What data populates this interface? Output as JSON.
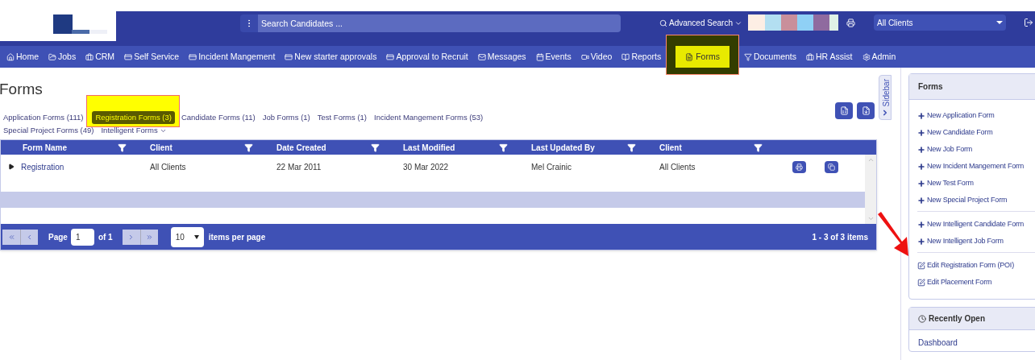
{
  "header": {
    "search": {
      "placeholder": "Search Candidates ..."
    },
    "advanced_search": "Advanced Search",
    "client_select": "All Clients"
  },
  "nav": [
    {
      "label": "Home",
      "selected": false
    },
    {
      "label": "Jobs",
      "selected": false
    },
    {
      "label": "CRM",
      "selected": false
    },
    {
      "label": "Self Service",
      "selected": false
    },
    {
      "label": "Incident Mangement",
      "selected": false
    },
    {
      "label": "New starter approvals",
      "selected": false
    },
    {
      "label": "Approval to Recruit",
      "selected": false
    },
    {
      "label": "Messages",
      "selected": false
    },
    {
      "label": "Events",
      "selected": false
    },
    {
      "label": "Video",
      "selected": false
    },
    {
      "label": "Reports",
      "selected": false
    },
    {
      "label": "Forms",
      "selected": true
    },
    {
      "label": "Documents",
      "selected": false
    },
    {
      "label": "HR Assist",
      "selected": false
    },
    {
      "label": "Admin",
      "selected": false
    }
  ],
  "page_title": "Forms",
  "tabs": [
    {
      "label": "Application Forms (111)",
      "kind": "link",
      "selected": false
    },
    {
      "label": "Registration Forms (3)",
      "kind": "link",
      "selected": true
    },
    {
      "label": "Candidate Forms (11)",
      "kind": "link",
      "selected": false
    },
    {
      "label": "Job Forms (1)",
      "kind": "link",
      "selected": false
    },
    {
      "label": "Test Forms (1)",
      "kind": "link",
      "selected": false
    },
    {
      "label": "Incident Mangement Forms (53)",
      "kind": "link",
      "selected": false
    },
    {
      "label": "Special Project Forms (49)",
      "kind": "link",
      "selected": false
    },
    {
      "label": "Intelligent Forms",
      "kind": "dropdown",
      "selected": false
    }
  ],
  "sidebar_tab": "Sidebar",
  "table": {
    "columns": [
      "Form Name",
      "Client",
      "Date Created",
      "Last Modified",
      "Last Updated By",
      "Client"
    ],
    "rows": [
      {
        "cells": [
          "Registration",
          "All Clients",
          "22 Mar 2011",
          "30 Mar 2022",
          "Mel Crainic",
          "All Clients"
        ]
      }
    ],
    "pager": {
      "page_label": "Page",
      "page": "1",
      "of": "of 1",
      "per_page": "10",
      "per_page_label": "items per page",
      "summary": "1 - 3 of 3 items"
    }
  },
  "forms_panel": {
    "title": "Forms",
    "groups": [
      [
        {
          "label": "New Application Form",
          "kind": "new"
        },
        {
          "label": "New Candidate Form",
          "kind": "new"
        },
        {
          "label": "New Job Form",
          "kind": "new"
        },
        {
          "label": "New Incident Mangement Form",
          "kind": "new"
        },
        {
          "label": "New Test Form",
          "kind": "new"
        },
        {
          "label": "New Special Project Form",
          "kind": "new"
        }
      ],
      [
        {
          "label": "New Intelligent Candidate Form",
          "kind": "new"
        },
        {
          "label": "New Intelligent Job Form",
          "kind": "new"
        }
      ],
      [
        {
          "label": "Edit Registration Form (POI)",
          "kind": "edit"
        },
        {
          "label": "Edit Placement Form",
          "kind": "edit"
        }
      ]
    ]
  },
  "recent_panel": {
    "title": "Recently Open",
    "items": [
      "Dashboard"
    ]
  }
}
